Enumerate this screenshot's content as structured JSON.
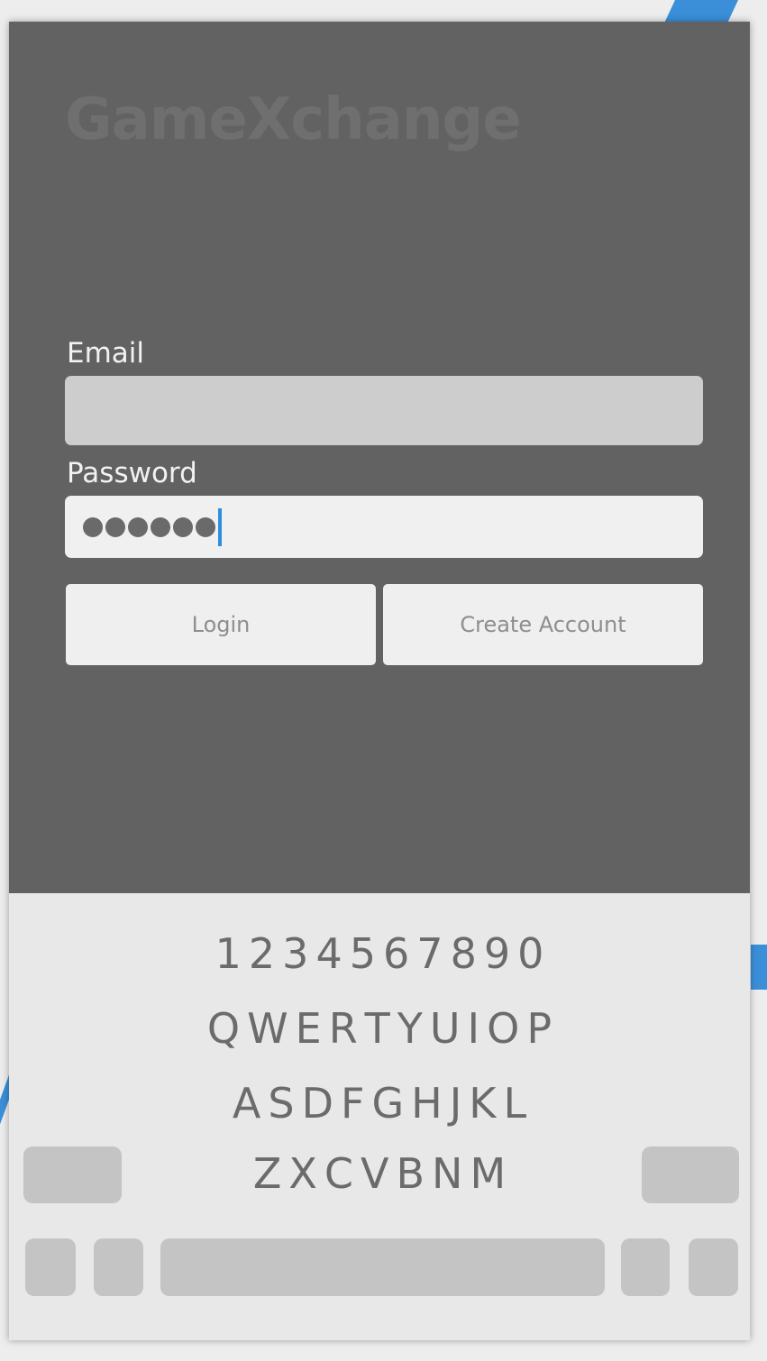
{
  "app": {
    "title": "GameXchange"
  },
  "form": {
    "email_label": "Email",
    "email_value": "",
    "password_label": "Password",
    "password_masked_length": 6
  },
  "buttons": {
    "login": "Login",
    "create_account": "Create Account"
  },
  "keyboard": {
    "row_numbers": [
      "1",
      "2",
      "3",
      "4",
      "5",
      "6",
      "7",
      "8",
      "9",
      "0"
    ],
    "row_qwerty": [
      "Q",
      "W",
      "E",
      "R",
      "T",
      "Y",
      "U",
      "I",
      "O",
      "P"
    ],
    "row_asdf": [
      "A",
      "S",
      "D",
      "F",
      "G",
      "H",
      "J",
      "K",
      "L"
    ],
    "row_zxcv": [
      "Z",
      "X",
      "C",
      "V",
      "B",
      "N",
      "M"
    ]
  },
  "colors": {
    "background_panel": "#626262",
    "title": "#6f6f6f",
    "accent_caret": "#2d8ee0",
    "keyboard_bg": "#e8e8e8"
  }
}
